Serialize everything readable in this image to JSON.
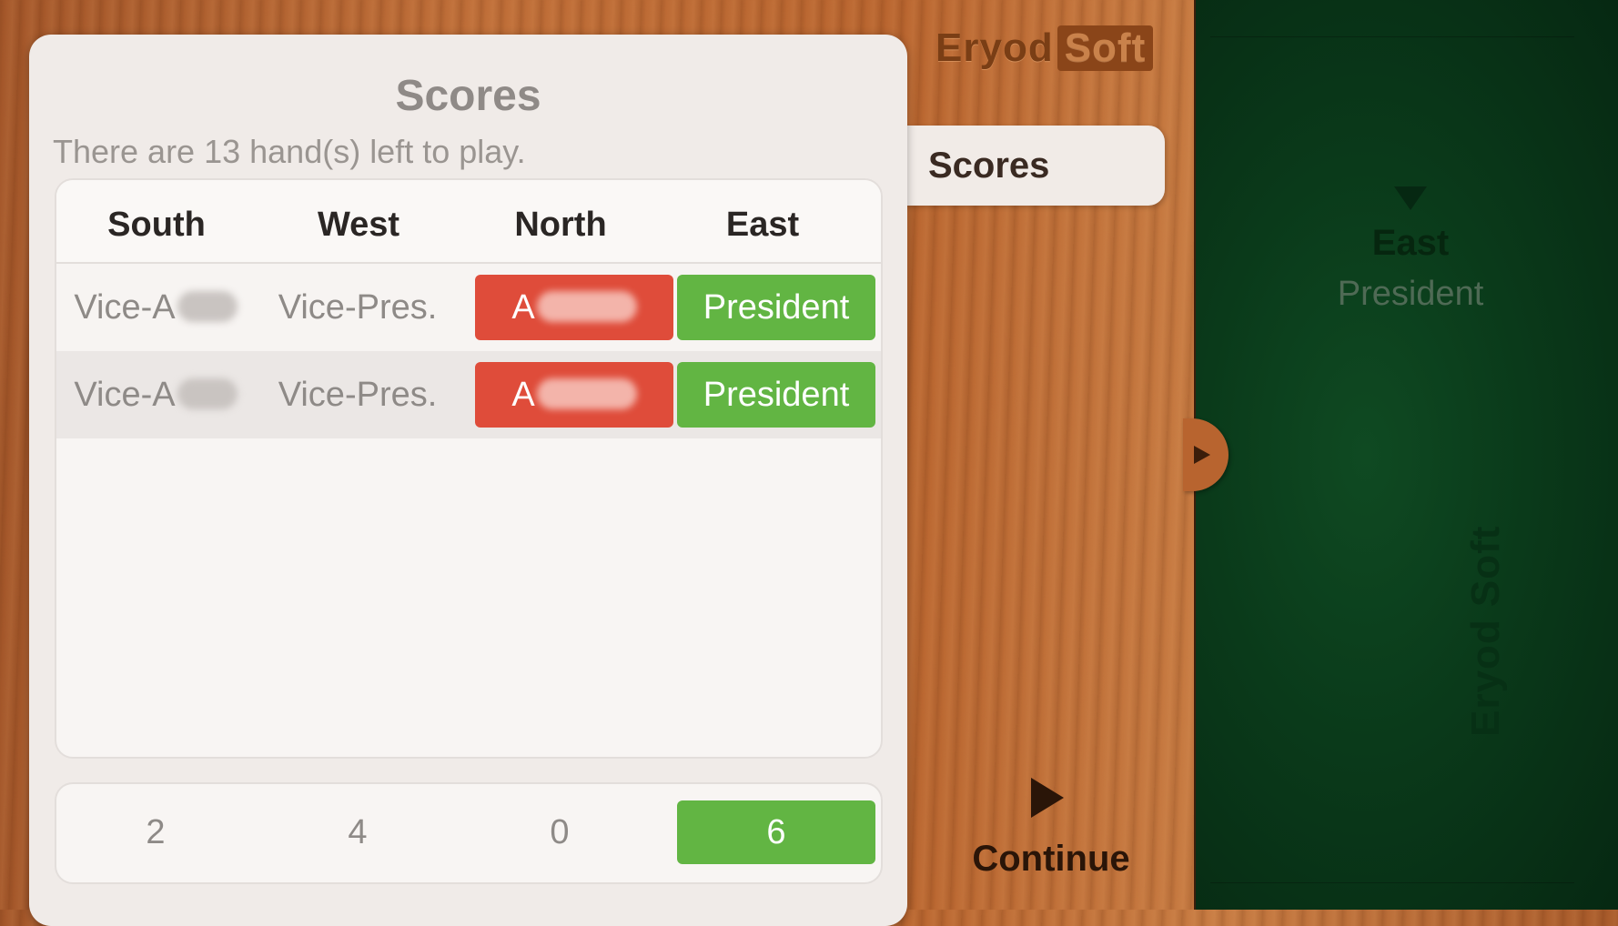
{
  "brand": {
    "part1": "Eryod",
    "part2": "Soft"
  },
  "side_tab": {
    "label": "Scores"
  },
  "continue": {
    "label": "Continue"
  },
  "felt": {
    "player_name": "East",
    "player_rank": "President",
    "logo": "Eryod Soft"
  },
  "scores_panel": {
    "title": "Scores",
    "subtitle": "There are 13 hand(s) left to play.",
    "columns": [
      "South",
      "West",
      "North",
      "East"
    ],
    "rows": [
      {
        "south": "Vice-A",
        "west": "Vice-Pres.",
        "north": "A",
        "east": "President"
      },
      {
        "south": "Vice-A",
        "west": "Vice-Pres.",
        "north": "A",
        "east": "President"
      }
    ],
    "totals": [
      "2",
      "4",
      "0",
      "6"
    ]
  },
  "colors": {
    "loser": "#df4c3a",
    "winner": "#62b543",
    "felt": "#0a3a1a"
  }
}
